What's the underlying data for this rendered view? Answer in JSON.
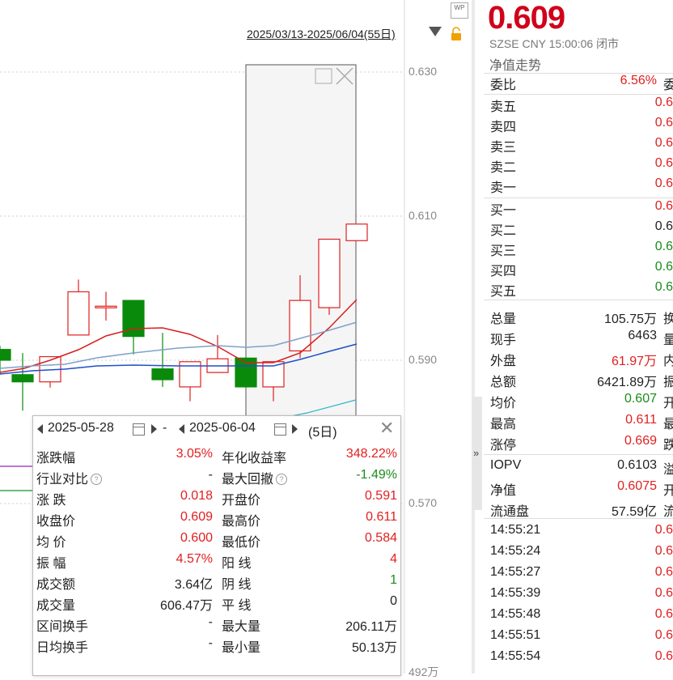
{
  "chart": {
    "range_label": "2025/03/13-2025/06/04(55日)",
    "y_axis_ticks": [
      "0.630",
      "0.610",
      "0.590",
      "0.570",
      "492万"
    ],
    "colors": {
      "up": "#e02020",
      "down": "#0a8a0a",
      "ma5": "#d81e1e",
      "ma10": "#7fa1c8",
      "ma20": "#1f4fc9",
      "vol_line": "#2fb7c7"
    },
    "candles": [
      {
        "open": 0.5915,
        "close": 0.59,
        "high": 0.592,
        "low": 0.588
      },
      {
        "open": 0.588,
        "close": 0.587,
        "high": 0.591,
        "low": 0.583
      },
      {
        "open": 0.587,
        "close": 0.5905,
        "high": 0.5905,
        "low": 0.5862
      },
      {
        "open": 0.5935,
        "close": 0.5995,
        "high": 0.6012,
        "low": 0.5935
      },
      {
        "open": 0.5975,
        "close": 0.5975,
        "high": 0.5995,
        "low": 0.5955
      },
      {
        "open": 0.5983,
        "close": 0.5933,
        "high": 0.5983,
        "low": 0.5908
      },
      {
        "open": 0.5888,
        "close": 0.5873,
        "high": 0.5938,
        "low": 0.5863
      },
      {
        "open": 0.5863,
        "close": 0.5898,
        "high": 0.5898,
        "low": 0.5843
      },
      {
        "open": 0.5883,
        "close": 0.5902,
        "high": 0.5935,
        "low": 0.5883
      },
      {
        "open": 0.5903,
        "close": 0.5863,
        "high": 0.5903,
        "low": 0.5863
      },
      {
        "open": 0.5863,
        "close": 0.5898,
        "high": 0.5898,
        "low": 0.5843
      },
      {
        "open": 0.5913,
        "close": 0.5983,
        "high": 0.6018,
        "low": 0.5903
      },
      {
        "open": 0.5973,
        "close": 0.6068,
        "high": 0.6068,
        "low": 0.5963
      },
      {
        "open": 0.6066,
        "close": 0.6089,
        "high": 0.6089,
        "low": 0.6066
      }
    ]
  },
  "popup": {
    "start_date": "2025-05-28",
    "end_date": "2025-06-04",
    "dash": "-",
    "days": "(5日)",
    "rows": [
      {
        "l1": "涨跌幅",
        "v1": "3.05%",
        "c1": "red",
        "l2": "年化收益率",
        "v2": "348.22%",
        "c2": "red",
        "h1": false,
        "h2": false
      },
      {
        "l1": "行业对比",
        "v1": "-",
        "c1": "dark",
        "l2": "最大回撤",
        "v2": "-1.49%",
        "c2": "green",
        "h1": true,
        "h2": true
      },
      {
        "l1": "涨  跌",
        "v1": "0.018",
        "c1": "red",
        "l2": "开盘价",
        "v2": "0.591",
        "c2": "red",
        "h1": false,
        "h2": false
      },
      {
        "l1": "收盘价",
        "v1": "0.609",
        "c1": "red",
        "l2": "最高价",
        "v2": "0.611",
        "c2": "red",
        "h1": false,
        "h2": false
      },
      {
        "l1": "均  价",
        "v1": "0.600",
        "c1": "red",
        "l2": "最低价",
        "v2": "0.584",
        "c2": "red",
        "h1": false,
        "h2": false
      },
      {
        "l1": "振  幅",
        "v1": "4.57%",
        "c1": "red",
        "l2": "阳  线",
        "v2": "4",
        "c2": "red",
        "h1": false,
        "h2": false
      },
      {
        "l1": "成交额",
        "v1": "3.64亿",
        "c1": "dark",
        "l2": "阴  线",
        "v2": "1",
        "c2": "green",
        "h1": false,
        "h2": false
      },
      {
        "l1": "成交量",
        "v1": "606.47万",
        "c1": "dark",
        "l2": "平  线",
        "v2": "0",
        "c2": "dark",
        "h1": false,
        "h2": false
      },
      {
        "l1": "区间换手",
        "v1": "-",
        "c1": "dark",
        "l2": "最大量",
        "v2": "206.11万",
        "c2": "dark",
        "h1": false,
        "h2": false
      },
      {
        "l1": "日均换手",
        "v1": "-",
        "c1": "dark",
        "l2": "最小量",
        "v2": "50.13万",
        "c2": "dark",
        "h1": false,
        "h2": false
      }
    ]
  },
  "quote": {
    "price": "0.609",
    "meta": "SZSE  CNY  15:00:06  闭市",
    "nav_link": "净值走势",
    "weibi": {
      "label": "委比",
      "value": "6.56%",
      "extra": "委"
    },
    "order_book": [
      {
        "label": "卖五",
        "value": "0.6",
        "color": "red"
      },
      {
        "label": "卖四",
        "value": "0.6",
        "color": "red"
      },
      {
        "label": "卖三",
        "value": "0.6",
        "color": "red"
      },
      {
        "label": "卖二",
        "value": "0.6",
        "color": "red"
      },
      {
        "label": "卖一",
        "value": "0.6",
        "color": "red"
      },
      {
        "label": "买一",
        "value": "0.6",
        "color": "red"
      },
      {
        "label": "买二",
        "value": "0.6",
        "color": "dark"
      },
      {
        "label": "买三",
        "value": "0.6",
        "color": "green"
      },
      {
        "label": "买四",
        "value": "0.6",
        "color": "green"
      },
      {
        "label": "买五",
        "value": "0.6",
        "color": "green"
      }
    ],
    "stats": [
      {
        "label": "总量",
        "value": "105.75万",
        "color": "dark",
        "extra": "换"
      },
      {
        "label": "现手",
        "value": "6463",
        "color": "dark",
        "extra": "量"
      },
      {
        "label": "外盘",
        "value": "61.97万",
        "color": "red",
        "extra": "内"
      },
      {
        "label": "总额",
        "value": "6421.89万",
        "color": "dark",
        "extra": "振"
      },
      {
        "label": "均价",
        "value": "0.607",
        "color": "green",
        "extra": "开"
      },
      {
        "label": "最高",
        "value": "0.611",
        "color": "red",
        "extra": "最"
      },
      {
        "label": "涨停",
        "value": "0.669",
        "color": "red",
        "extra": "跌"
      }
    ],
    "fund": [
      {
        "label": "IOPV",
        "value": "0.6103",
        "color": "dark",
        "extra": "溢"
      },
      {
        "label": "净值",
        "value": "0.6075",
        "color": "red",
        "extra": "开"
      },
      {
        "label": "流通盘",
        "value": "57.59亿",
        "color": "dark",
        "extra": "流"
      }
    ],
    "ticks": [
      {
        "time": "14:55:21",
        "value": "0.6"
      },
      {
        "time": "14:55:24",
        "value": "0.6"
      },
      {
        "time": "14:55:27",
        "value": "0.6"
      },
      {
        "time": "14:55:39",
        "value": "0.6"
      },
      {
        "time": "14:55:48",
        "value": "0.6"
      },
      {
        "time": "14:55:51",
        "value": "0.6"
      },
      {
        "time": "14:55:54",
        "value": "0.6"
      }
    ]
  }
}
